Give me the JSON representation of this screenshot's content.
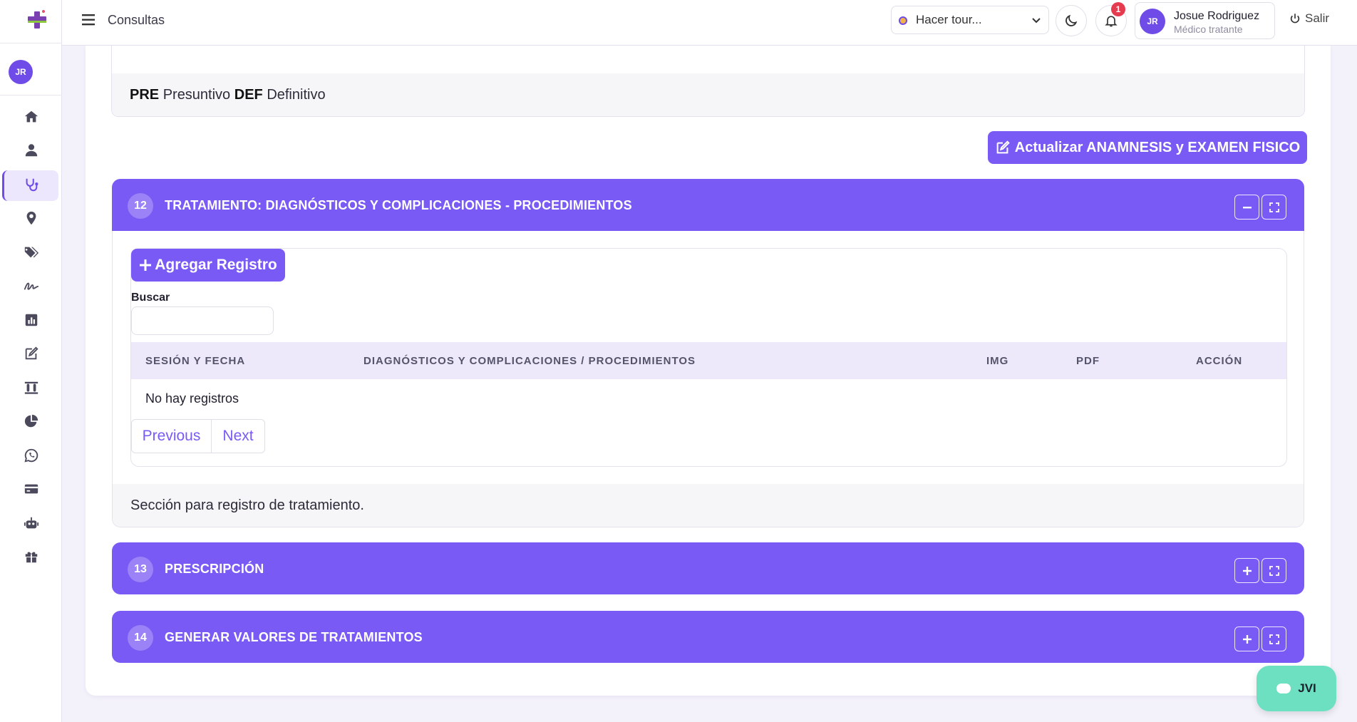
{
  "sidebar": {
    "avatar_initials": "JR",
    "items": [
      {
        "icon": "home-icon"
      },
      {
        "icon": "user-icon"
      },
      {
        "icon": "stethoscope-icon",
        "active": true
      },
      {
        "icon": "map-pin-icon"
      },
      {
        "icon": "tags-icon"
      },
      {
        "icon": "signature-icon"
      },
      {
        "icon": "bar-chart-icon"
      },
      {
        "icon": "edit-icon"
      },
      {
        "icon": "lab-tubes-icon"
      },
      {
        "icon": "pie-chart-icon"
      },
      {
        "icon": "whatsapp-icon"
      },
      {
        "icon": "credit-card-icon"
      },
      {
        "icon": "robot-icon"
      },
      {
        "icon": "gift-icon"
      }
    ]
  },
  "header": {
    "title": "Consultas",
    "tour_select": "Hacer tour...",
    "notification_count": "1",
    "user_initials": "JR",
    "user_name": "Josue Rodriguez",
    "user_role": "Médico tratante",
    "logout_label": "Salir"
  },
  "previous_section": {
    "footer_pre": "PRE",
    "footer_pre_text": "Presuntivo",
    "footer_def": "DEF",
    "footer_def_text": "Definitivo"
  },
  "update_button_label": "Actualizar ANAMNESIS y EXAMEN FISICO",
  "sections": {
    "treatment": {
      "number": "12",
      "title": "TRATAMIENTO: DIAGNÓSTICOS Y COMPLICACIONES - PROCEDIMIENTOS",
      "add_button": "Agregar Registro",
      "search_label": "Buscar",
      "search_value": "",
      "columns": [
        "SESIÓN Y FECHA",
        "DIAGNÓSTICOS Y COMPLICACIONES / PROCEDIMIENTOS",
        "IMG",
        "PDF",
        "ACCIÓN"
      ],
      "empty_text": "No hay registros",
      "pager_prev": "Previous",
      "pager_next": "Next",
      "footer": "Sección para registro de tratamiento."
    },
    "prescription": {
      "number": "13",
      "title": "PRESCRIPCIÓN"
    },
    "values": {
      "number": "14",
      "title": "GENERAR VALORES DE TRATAMIENTOS"
    }
  },
  "chat_fab_label": "JVI",
  "colors": {
    "accent": "#7a5af5",
    "fab": "#6ee0c2",
    "badge": "#e53b4e"
  }
}
